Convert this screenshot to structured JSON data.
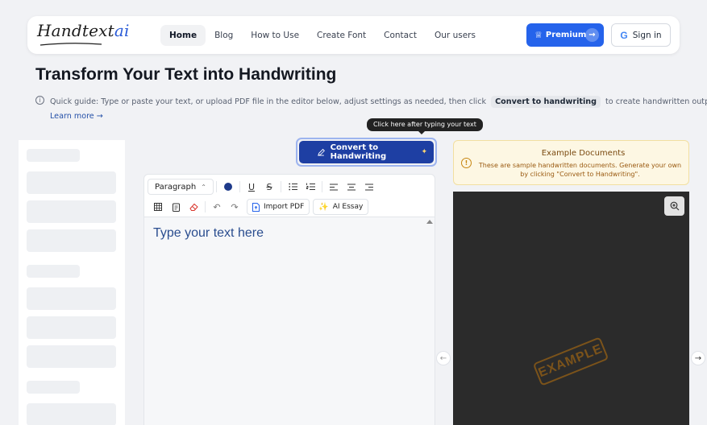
{
  "header": {
    "logo_main": "Handtext",
    "logo_suffix": "ai",
    "nav": [
      {
        "label": "Home",
        "active": true
      },
      {
        "label": "Blog"
      },
      {
        "label": "How to Use"
      },
      {
        "label": "Create Font"
      },
      {
        "label": "Contact"
      },
      {
        "label": "Our users"
      }
    ],
    "premium_label": "Premium",
    "signin_label": "Sign in"
  },
  "page": {
    "title": "Transform Your Text into Handwriting",
    "guide_prefix": "Quick guide: Type or paste your text, or upload PDF file in the editor below, adjust settings as needed, then click",
    "guide_chip": "Convert to handwriting",
    "guide_suffix": "to create handwritten output.",
    "learn_more": "Learn more →"
  },
  "editor": {
    "tooltip": "Click here after typing your text",
    "convert_label": "Convert to Handwriting",
    "paragraph_select": "Paragraph",
    "import_pdf": "Import PDF",
    "ai_essay": "AI Essay",
    "placeholder": "Type your text here"
  },
  "example": {
    "title": "Example Documents",
    "description": "These are sample handwritten documents. Generate your own by clicking \"Convert to Handwriting\".",
    "stamp": "EXAMPLE"
  },
  "colors": {
    "primary": "#2563eb",
    "convert_button": "#1e3fa3",
    "text_color": "#1e3a8a",
    "notice_bg": "#fdf7e3",
    "preview_bg": "#2b2b2b"
  }
}
